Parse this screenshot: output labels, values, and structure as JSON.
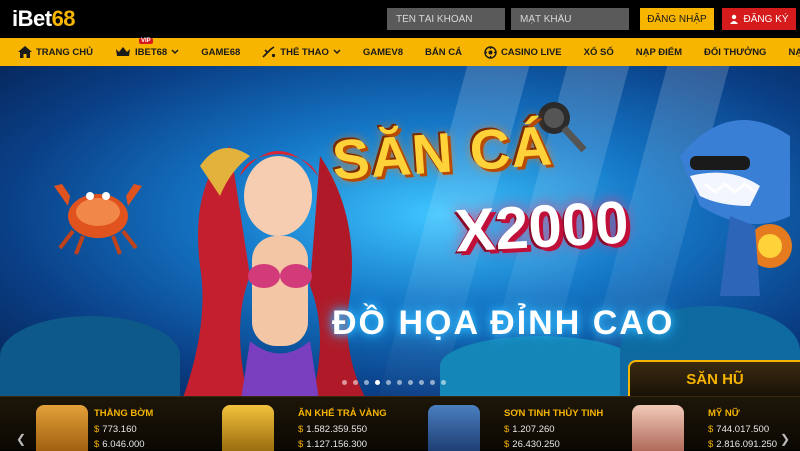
{
  "header": {
    "logo_prefix": "iBet",
    "logo_suffix": "68",
    "username_placeholder": "TÊN TÀI KHOẢN",
    "password_placeholder": "MẬT KHẨU",
    "login_label": "ĐĂNG NHẬP",
    "register_label": "ĐĂNG KÝ"
  },
  "nav": {
    "vip_badge": "VIP",
    "items": [
      {
        "label": "TRANG CHỦ",
        "icon": "home-icon"
      },
      {
        "label": "IBET68",
        "icon": "vip-icon",
        "dropdown": true
      },
      {
        "label": "GAME68"
      },
      {
        "label": "THỂ THAO",
        "icon": "sports-icon",
        "dropdown": true
      },
      {
        "label": "GAMEV8"
      },
      {
        "label": "BẮN CÁ"
      },
      {
        "label": "CASINO LIVE",
        "icon": "casino-icon"
      },
      {
        "label": "XỔ SỐ"
      },
      {
        "label": "NẠP ĐIỂM"
      },
      {
        "label": "ĐỔI THƯỞNG"
      },
      {
        "label": "NẠP CODE"
      }
    ]
  },
  "banner": {
    "headline1": "SĂN CÁ",
    "headline2": "X2000",
    "tagline": "ĐỒ HỌA ĐỈNH CAO",
    "slide_count": 10,
    "active_slide": 3
  },
  "jackpot": {
    "title": "SĂN HŨ",
    "currency": "$",
    "games": [
      {
        "name": "THẰNG BỜM",
        "value1": "773.160",
        "value2": "6.046.000"
      },
      {
        "name": "ĂN KHẾ TRẢ VÀNG",
        "value1": "1.582.359.550",
        "value2": "1.127.156.300"
      },
      {
        "name": "SƠN TINH THỦY TINH",
        "value1": "1.207.260",
        "value2": "26.430.250"
      },
      {
        "name": "MỸ NỮ",
        "value1": "744.017.500",
        "value2": "2.816.091.250"
      }
    ]
  },
  "colors": {
    "brand_yellow": "#f7b500",
    "register_red": "#d51b1b",
    "topbar_black": "#000000"
  }
}
